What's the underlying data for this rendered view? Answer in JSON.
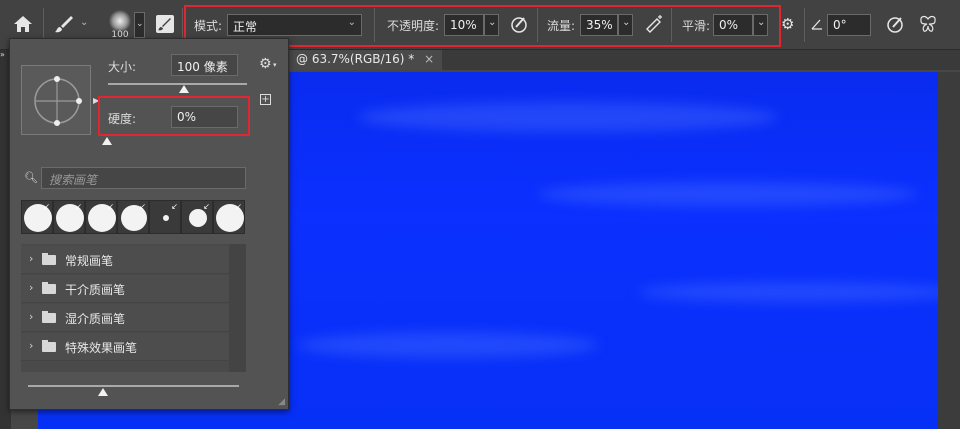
{
  "options_bar": {
    "brush_size_preview": "100",
    "mode_label": "模式:",
    "mode_value": "正常",
    "opacity_label": "不透明度:",
    "opacity_value": "10%",
    "flow_label": "流量:",
    "flow_value": "35%",
    "smoothing_label": "平滑:",
    "smoothing_value": "0%",
    "angle_value": "0°"
  },
  "document_tab": {
    "title": "@ 63.7%(RGB/16) *",
    "close": "×"
  },
  "brush_panel": {
    "size_label": "大小:",
    "size_value": "100 像素",
    "hardness_label": "硬度:",
    "hardness_value": "0%",
    "search_placeholder": "搜索画笔",
    "folders": [
      "常规画笔",
      "干介质画笔",
      "湿介质画笔",
      "特殊效果画笔"
    ]
  },
  "highlight_color": "#e0262e",
  "canvas_color": "#0b30ff"
}
